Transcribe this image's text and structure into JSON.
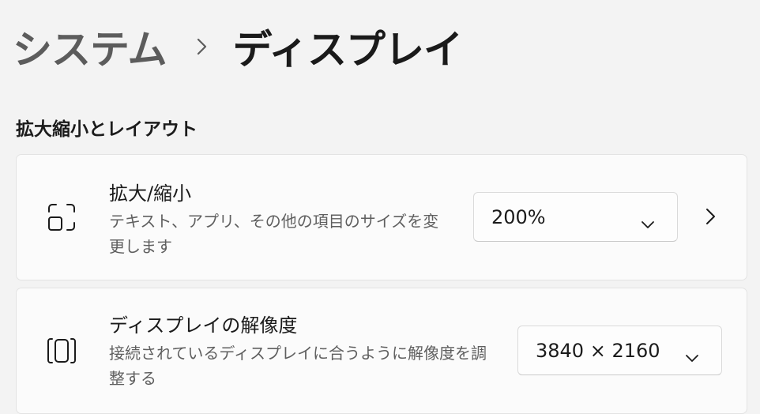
{
  "breadcrumb": {
    "parent": "システム",
    "separator_icon": "chevron-right-icon",
    "current": "ディスプレイ"
  },
  "section": {
    "title": "拡大縮小とレイアウト"
  },
  "settings": [
    {
      "icon": "scale-icon",
      "title": "拡大/縮小",
      "description_line1": "テキスト、アプリ、その他の項目のサイズを変",
      "description_line2": "更します",
      "value": "200%",
      "has_nav_arrow": true
    },
    {
      "icon": "resolution-icon",
      "title": "ディスプレイの解像度",
      "description_line1": "接続されているディスプレイに合うように解像度を調",
      "description_line2": "整する",
      "value": "3840 × 2160",
      "has_nav_arrow": false
    }
  ],
  "colors": {
    "background": "#f3f3f3",
    "card": "#fbfbfb",
    "text_primary": "#1b1b1b",
    "text_secondary": "#5f5f5f"
  }
}
